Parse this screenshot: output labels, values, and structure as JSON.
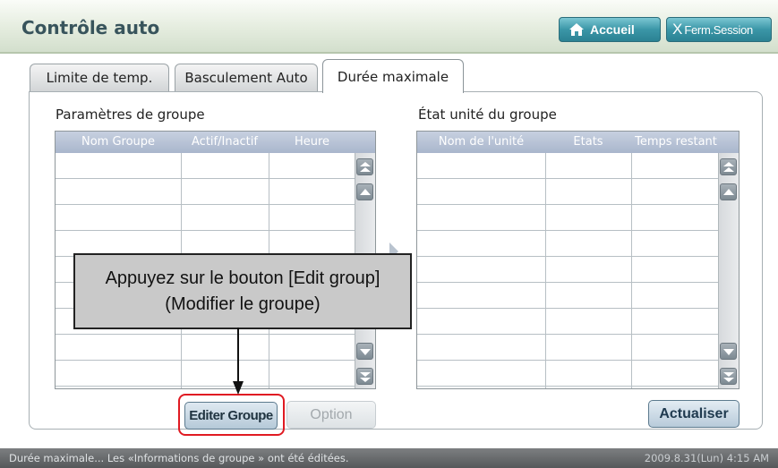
{
  "header": {
    "title": "Contrôle auto",
    "home_label": "Accueil",
    "logout_x": "X",
    "logout_label": "Ferm.Session"
  },
  "tabs": [
    {
      "label": "Limite de temp."
    },
    {
      "label": "Basculement Auto"
    },
    {
      "label": "Durée maximale",
      "active": true
    }
  ],
  "group_settings": {
    "title": "Paramètres de groupe",
    "columns": [
      "Nom Groupe",
      "Actif/Inactif",
      "Heure"
    ]
  },
  "unit_status": {
    "title": "État unité du groupe",
    "columns": [
      "Nom de l'unité",
      "Etats",
      "Temps restant"
    ]
  },
  "buttons": {
    "edit_group": "Editer Groupe",
    "option": "Option",
    "refresh": "Actualiser"
  },
  "callout": {
    "line1": "Appuyez sur le bouton [Edit group]",
    "line2": "(Modifier le groupe)"
  },
  "status_bar": {
    "message": "Durée maximale... Les «Informations de groupe » ont été éditées.",
    "datetime": "2009.8.31(Lun)  4:15 AM"
  },
  "colors": {
    "accent": "#3b96a7",
    "highlight": "#e01a22",
    "table_header": "#a9b6cc"
  }
}
